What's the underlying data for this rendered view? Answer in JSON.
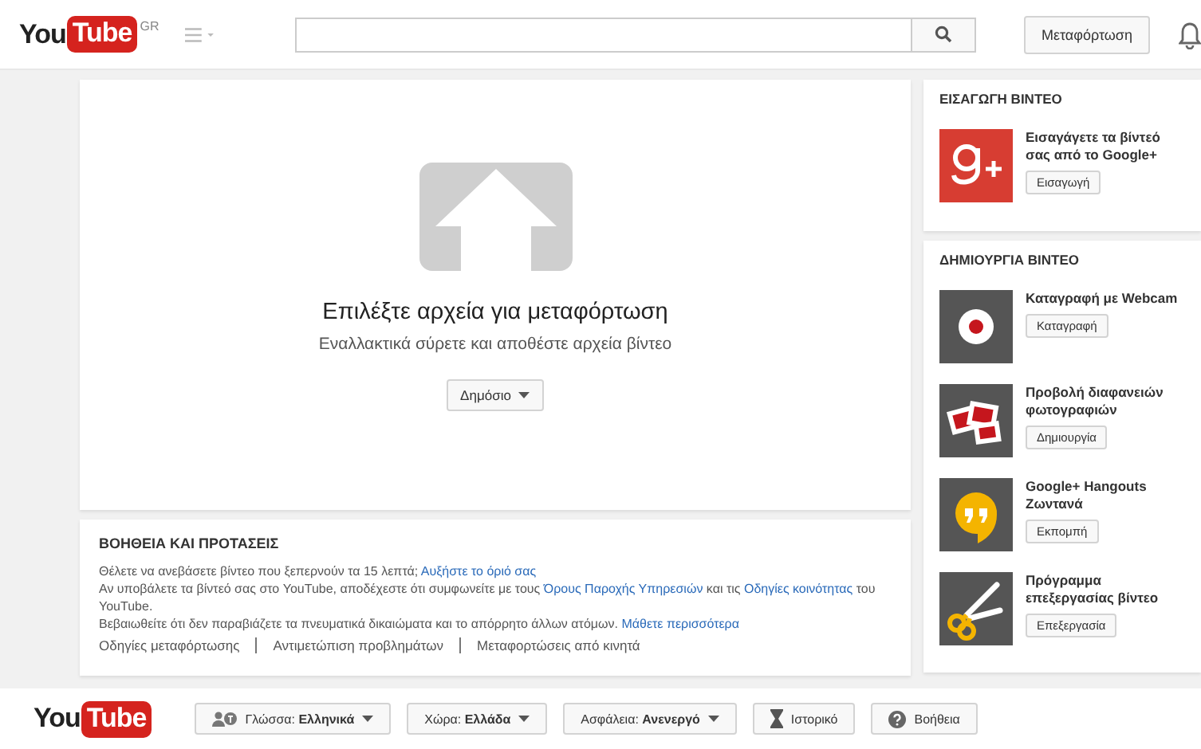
{
  "header": {
    "logo": {
      "you": "You",
      "tube": "Tube",
      "region": "GR"
    },
    "upload_button": "Μεταφόρτωση"
  },
  "upload": {
    "title": "Επιλέξτε αρχεία για μεταφόρτωση",
    "subtitle": "Εναλλακτικά σύρετε και αποθέστε αρχεία βίντεο",
    "privacy": "Δημόσιο"
  },
  "help": {
    "title": "ΒΟΗΘΕΙΑ ΚΑΙ ΠΡΟΤΑΣΕΙΣ",
    "paragraphs": [
      [
        {
          "text": "Θέλετε να ανεβάσετε βίντεο που ξεπερνούν τα 15 λεπτά; ",
          "link": false
        },
        {
          "text": "Αυξήστε το όριό σας",
          "link": true
        }
      ],
      [
        {
          "text": "Αν υποβάλετε τα βίντεό σας στο YouTube, αποδέχεστε ότι συμφωνείτε με τους ",
          "link": false
        },
        {
          "text": "Όρους Παροχής Υπηρεσιών",
          "link": true
        },
        {
          "text": " και τις ",
          "link": false
        },
        {
          "text": "Οδηγίες κοινότητας",
          "link": true
        },
        {
          "text": " του YouTube.",
          "link": false
        }
      ],
      [
        {
          "text": "Βεβαιωθείτε ότι δεν παραβιάζετε τα πνευματικά δικαιώματα και το απόρρητο άλλων ατόμων. ",
          "link": false
        },
        {
          "text": "Μάθετε περισσότερα",
          "link": true
        }
      ]
    ],
    "links": [
      "Οδηγίες μεταφόρτωσης",
      "Αντιμετώπιση προβλημάτων",
      "Μεταφορτώσεις από κινητά"
    ]
  },
  "sidebar": [
    {
      "title": "ΕΙΣΑΓΩΓΗ ΒΙΝΤΕΟ",
      "items": [
        {
          "kind": "googleplus",
          "label": "Εισαγάγετε τα βίντεό σας από το Google+",
          "button": "Εισαγωγή"
        }
      ]
    },
    {
      "title": "ΔΗΜΙΟΥΡΓΙΑ ΒΙΝΤΕΟ",
      "items": [
        {
          "kind": "record",
          "label": "Καταγραφή με Webcam",
          "button": "Καταγραφή"
        },
        {
          "kind": "slides",
          "label": "Προβολή διαφανειών φωτογραφιών",
          "button": "Δημιουργία"
        },
        {
          "kind": "hangouts",
          "label": "Google+ Hangouts Ζωντανά",
          "button": "Εκπομπή"
        },
        {
          "kind": "scissors",
          "label": "Πρόγραμμα επεξεργασίας βίντεο",
          "button": "Επεξεργασία"
        }
      ]
    }
  ],
  "footer": {
    "logo": {
      "you": "You",
      "tube": "Tube"
    },
    "buttons": [
      {
        "kind": "language",
        "label": "Γλώσσα: **Ελληνικά**"
      },
      {
        "kind": "dropdown",
        "label": "Χώρα: **Ελλάδα**"
      },
      {
        "kind": "dropdown",
        "label": "Ασφάλεια: **Ανενεργό**"
      },
      {
        "kind": "history",
        "label": "Ιστορικό"
      },
      {
        "kind": "help",
        "label": "Βοήθεια"
      }
    ]
  }
}
